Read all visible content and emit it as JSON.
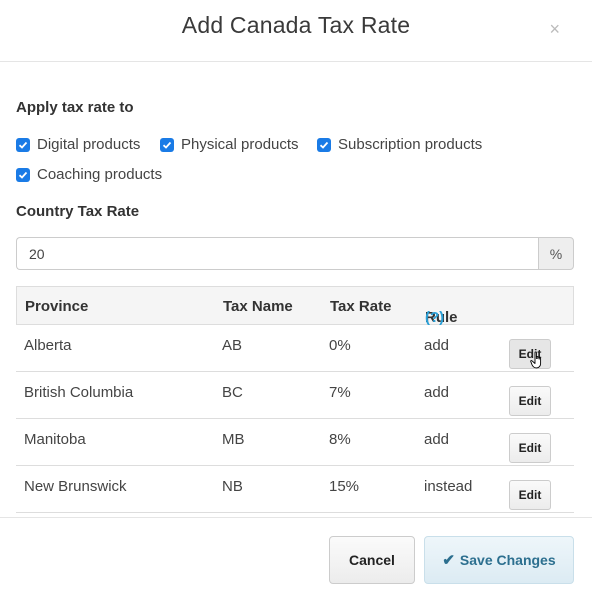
{
  "modal": {
    "title": "Add Canada Tax Rate",
    "close_label": "×"
  },
  "apply": {
    "label": "Apply tax rate to",
    "options": [
      {
        "label": "Digital products",
        "checked": true
      },
      {
        "label": "Physical products",
        "checked": true
      },
      {
        "label": "Subscription products",
        "checked": true
      },
      {
        "label": "Coaching products",
        "checked": true
      }
    ]
  },
  "country_rate": {
    "label": "Country Tax Rate",
    "value": "20",
    "unit": "%"
  },
  "table": {
    "headers": {
      "province": "Province",
      "tax_name": "Tax Name",
      "tax_rate": "Tax Rate",
      "rule": "Rule",
      "rule_help": "(?)"
    },
    "rows": [
      {
        "province": "Alberta",
        "tax_name": "AB",
        "tax_rate": "0%",
        "rule": "add",
        "action": "Edit"
      },
      {
        "province": "British Columbia",
        "tax_name": "BC",
        "tax_rate": "7%",
        "rule": "add",
        "action": "Edit"
      },
      {
        "province": "Manitoba",
        "tax_name": "MB",
        "tax_rate": "8%",
        "rule": "add",
        "action": "Edit"
      },
      {
        "province": "New Brunswick",
        "tax_name": "NB",
        "tax_rate": "15%",
        "rule": "instead",
        "action": "Edit"
      }
    ]
  },
  "footer": {
    "cancel_label": "Cancel",
    "save_label": "Save Changes"
  },
  "colors": {
    "checkbox": "#1a7be6",
    "help_link": "#2a9fd6",
    "save_text": "#2c6f8f"
  }
}
